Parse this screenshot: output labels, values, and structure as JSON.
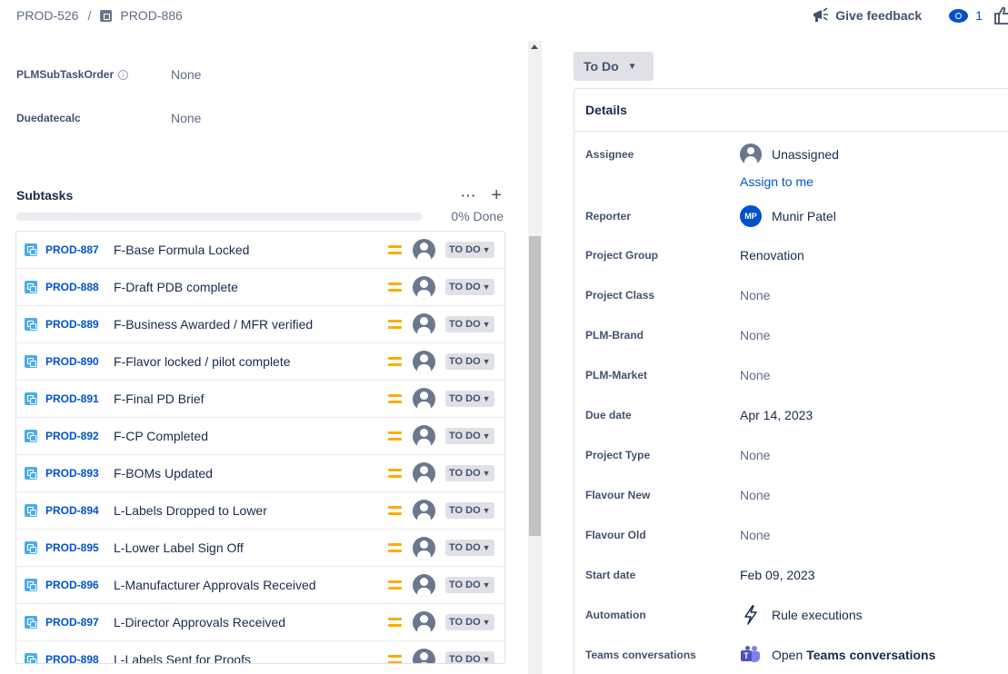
{
  "breadcrumb": {
    "parent": "PROD-526",
    "separator": "/",
    "current": "PROD-886"
  },
  "top_actions": {
    "feedback_label": "Give feedback",
    "watch_count": "1"
  },
  "left_fields": [
    {
      "label": "PLMSubTaskOrder",
      "value": "None",
      "has_info": true
    },
    {
      "label": "Duedatecalc",
      "value": "None",
      "has_info": false
    }
  ],
  "subtasks": {
    "title": "Subtasks",
    "more_label": "···",
    "add_label": "+",
    "progress_percent": 0,
    "progress_label": "0% Done",
    "items": [
      {
        "key": "PROD-887",
        "summary": "F-Base Formula Locked",
        "status": "TO DO"
      },
      {
        "key": "PROD-888",
        "summary": "F-Draft PDB complete",
        "status": "TO DO"
      },
      {
        "key": "PROD-889",
        "summary": "F-Business Awarded / MFR verified",
        "status": "TO DO"
      },
      {
        "key": "PROD-890",
        "summary": "F-Flavor locked / pilot complete",
        "status": "TO DO"
      },
      {
        "key": "PROD-891",
        "summary": "F-Final PD Brief",
        "status": "TO DO"
      },
      {
        "key": "PROD-892",
        "summary": "F-CP Completed",
        "status": "TO DO"
      },
      {
        "key": "PROD-893",
        "summary": "F-BOMs Updated",
        "status": "TO DO"
      },
      {
        "key": "PROD-894",
        "summary": "L-Labels Dropped to Lower",
        "status": "TO DO"
      },
      {
        "key": "PROD-895",
        "summary": "L-Lower Label Sign Off",
        "status": "TO DO"
      },
      {
        "key": "PROD-896",
        "summary": "L-Manufacturer Approvals Received",
        "status": "TO DO"
      },
      {
        "key": "PROD-897",
        "summary": "L-Director Approvals Received",
        "status": "TO DO"
      },
      {
        "key": "PROD-898",
        "summary": "L-Labels Sent for Proofs",
        "status": "TO DO"
      }
    ]
  },
  "status_button": {
    "label": "To Do"
  },
  "details": {
    "title": "Details",
    "assignee": {
      "label": "Assignee",
      "value": "Unassigned",
      "assign_link": "Assign to me"
    },
    "reporter": {
      "label": "Reporter",
      "value": "Munir Patel",
      "initials": "MP"
    },
    "project_group": {
      "label": "Project Group",
      "value": "Renovation"
    },
    "project_class": {
      "label": "Project Class",
      "value": "None"
    },
    "plm_brand": {
      "label": "PLM-Brand",
      "value": "None"
    },
    "plm_market": {
      "label": "PLM-Market",
      "value": "None"
    },
    "due_date": {
      "label": "Due date",
      "value": "Apr 14, 2023"
    },
    "project_type": {
      "label": "Project Type",
      "value": "None"
    },
    "flavour_new": {
      "label": "Flavour New",
      "value": "None"
    },
    "flavour_old": {
      "label": "Flavour Old",
      "value": "None"
    },
    "start_date": {
      "label": "Start date",
      "value": "Feb 09, 2023"
    },
    "automation": {
      "label": "Automation",
      "value": "Rule executions"
    },
    "teams": {
      "label": "Teams conversations",
      "value_prefix": "Open",
      "value_bold": "Teams conversations"
    }
  },
  "colors": {
    "link": "#0052cc",
    "priority_medium": "#ffab00",
    "subtask_icon": "#4bade8",
    "lozenge_bg": "#dfe1e6"
  }
}
